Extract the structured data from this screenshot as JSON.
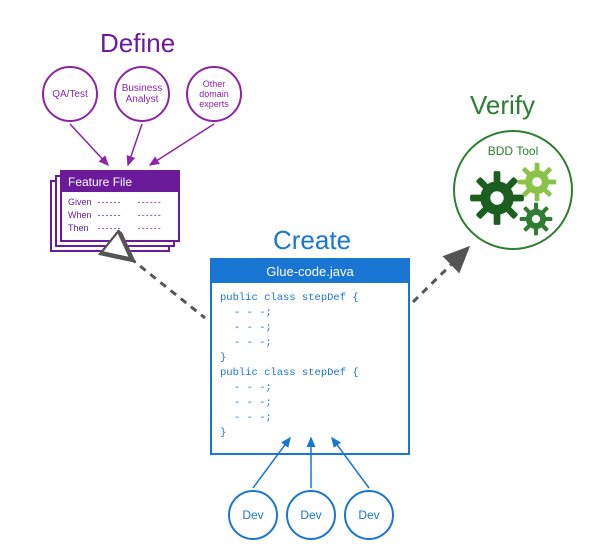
{
  "titles": {
    "define": "Define",
    "create": "Create",
    "verify": "Verify"
  },
  "roles": {
    "qa": "QA/Test",
    "ba": "Business\nAnalyst",
    "other": "Other\ndomain\nexperts"
  },
  "feature": {
    "header": "Feature File",
    "gwt": [
      "Given",
      "When",
      "Then"
    ],
    "line": "------"
  },
  "glue": {
    "filename": "Glue-code.java",
    "class_line": "public class stepDef {",
    "stmt": "- - -;",
    "close": "}"
  },
  "dev": {
    "label": "Dev"
  },
  "bdd": {
    "label": "BDD Tool"
  },
  "colors": {
    "purple": "#6a1b9a",
    "blue": "#1976d2",
    "green_dark": "#2e7d32",
    "green_mid": "#4caf50",
    "green_light": "#8bc34a",
    "gray": "#555555"
  }
}
